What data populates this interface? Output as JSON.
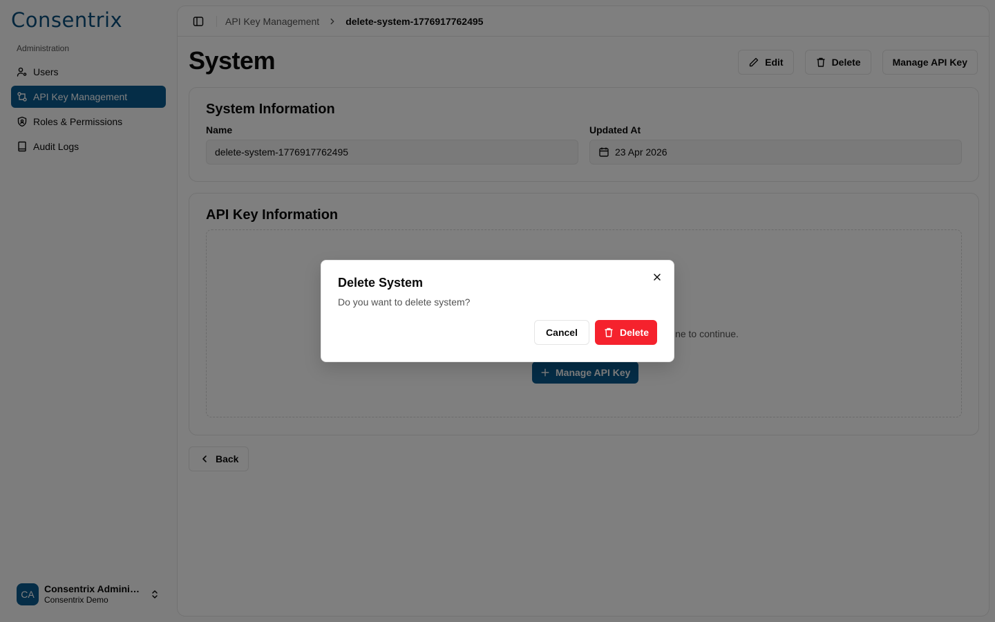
{
  "app": {
    "logo_text": "Consentrix",
    "brand_color": "#0b5a8f"
  },
  "sidebar": {
    "group_label": "Administration",
    "items": [
      {
        "label": "Users",
        "icon": "user-cog-icon",
        "active": false
      },
      {
        "label": "API Key Management",
        "icon": "key-management-icon",
        "active": true
      },
      {
        "label": "Roles & Permissions",
        "icon": "shield-icon",
        "active": false
      },
      {
        "label": "Audit Logs",
        "icon": "book-icon",
        "active": false
      }
    ],
    "user": {
      "initials": "CA",
      "name": "Consentrix Administ...",
      "org": "Consentrix Demo"
    }
  },
  "breadcrumb": {
    "parent": "API Key Management",
    "current": "delete-system-1776917762495"
  },
  "page": {
    "title": "System",
    "actions": {
      "edit": "Edit",
      "delete": "Delete",
      "manage": "Manage API Key"
    }
  },
  "system_info": {
    "title": "System Information",
    "name_label": "Name",
    "name_value": "delete-system-1776917762495",
    "updated_label": "Updated At",
    "updated_value": "23 Apr 2026"
  },
  "api_key_info": {
    "title": "API Key Information",
    "empty_text": "ne to continue.",
    "manage_button": "Manage API Key"
  },
  "back_label": "Back",
  "dialog": {
    "title": "Delete System",
    "description": "Do you want to delete system?",
    "cancel": "Cancel",
    "confirm": "Delete",
    "danger_color": "#f5222d"
  }
}
